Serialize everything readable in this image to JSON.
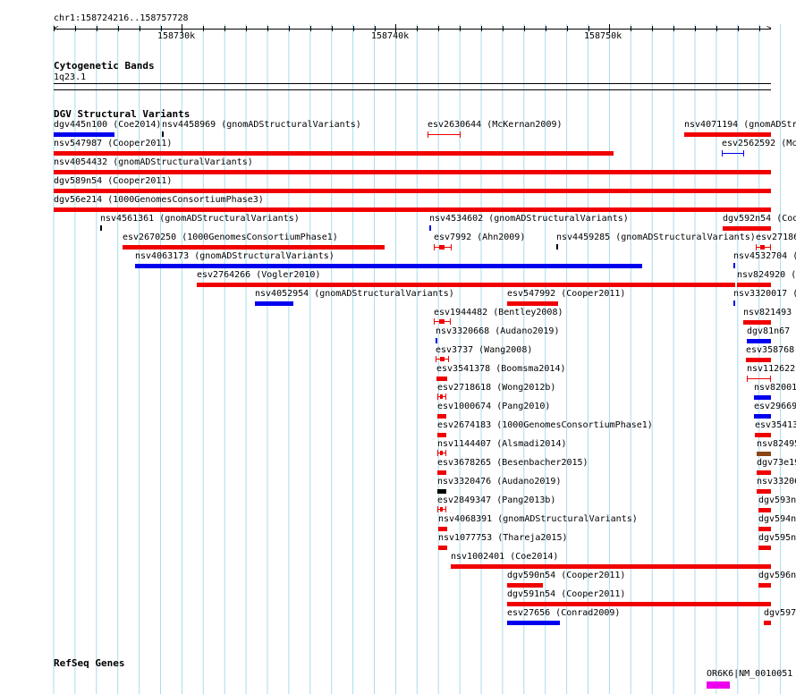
{
  "locus": "chr1:158724216..158757728",
  "ruler": {
    "ticks": [
      "158730k",
      "158740k",
      "158750k"
    ]
  },
  "tracks": {
    "cyto_title": "Cytogenetic Bands",
    "cyto_band": "1q23.1",
    "dgv_title": "DGV Structural Variants",
    "refseq_title": "RefSeq Genes"
  },
  "colors": {
    "red": "#f00000",
    "blue": "#0000ee",
    "brown": "#8b4513",
    "black": "#000000",
    "magenta": "#ee00ee",
    "grid": "#a8dcec"
  },
  "features": [
    {
      "label": "dgv445n100 (Coe2014)",
      "color": "blue",
      "style": "bar"
    },
    {
      "label": "nsv4458969 (gnomADStructuralVariants)",
      "color": "black",
      "style": "tick"
    },
    {
      "label": "esv2630644 (McKernan2009)",
      "color": "red",
      "style": "line"
    },
    {
      "label": "nsv4071194 (gnomADStr",
      "color": "red",
      "style": "bar"
    },
    {
      "label": "nsv547987 (Cooper2011)",
      "color": "red",
      "style": "bar"
    },
    {
      "label": "esv2562592 (Mc",
      "color": "blue",
      "style": "line"
    },
    {
      "label": "nsv4054432 (gnomADStructuralVariants)",
      "color": "red",
      "style": "bar"
    },
    {
      "label": "dgv589n54 (Cooper2011)",
      "color": "red",
      "style": "bar"
    },
    {
      "label": "dgv56e214 (1000GenomesConsortiumPhase3)",
      "color": "red",
      "style": "bar"
    },
    {
      "label": "nsv4561361 (gnomADStructuralVariants)",
      "color": "black",
      "style": "tick"
    },
    {
      "label": "nsv4534602 (gnomADStructuralVariants)",
      "color": "blue",
      "style": "tick"
    },
    {
      "label": "dgv592n54 (Coo",
      "color": "red",
      "style": "bar"
    },
    {
      "label": "esv2670250 (1000GenomesConsortiumPhase1)",
      "color": "red",
      "style": "bar"
    },
    {
      "label": "esv7992 (Ahn2009)",
      "color": "red",
      "style": "line"
    },
    {
      "label": "nsv4459285 (gnomADStructuralVariants)",
      "color": "black",
      "style": "tick"
    },
    {
      "label": "esv27186",
      "color": "red",
      "style": "line"
    },
    {
      "label": "nsv4063173 (gnomADStructuralVariants)",
      "color": "blue",
      "style": "bar"
    },
    {
      "label": "nsv4532704 (",
      "color": "blue",
      "style": "tick"
    },
    {
      "label": "esv2764266 (Vogler2010)",
      "color": "red",
      "style": "bar"
    },
    {
      "label": "nsv824920 (",
      "color": "red",
      "style": "bar"
    },
    {
      "label": "nsv4052954 (gnomADStructuralVariants)",
      "color": "blue",
      "style": "bar"
    },
    {
      "label": "esv547992 (Cooper2011)",
      "color": "red",
      "style": "bar"
    },
    {
      "label": "nsv3320017 (",
      "color": "blue",
      "style": "tick"
    },
    {
      "label": "esv1944482 (Bentley2008)",
      "color": "red",
      "style": "line"
    },
    {
      "label": "nsv821493",
      "color": "red",
      "style": "bar"
    },
    {
      "label": "nsv3320668 (Audano2019)",
      "color": "blue",
      "style": "tick"
    },
    {
      "label": "dgv81n67",
      "color": "blue",
      "style": "bar"
    },
    {
      "label": "esv3737 (Wang2008)",
      "color": "red",
      "style": "line"
    },
    {
      "label": "esv358768",
      "color": "red",
      "style": "bar"
    },
    {
      "label": "esv3541378 (Boomsma2014)",
      "color": "red",
      "style": "bar"
    },
    {
      "label": "nsv112622",
      "color": "red",
      "style": "line"
    },
    {
      "label": "esv2718618 (Wong2012b)",
      "color": "red",
      "style": "line"
    },
    {
      "label": "nsv82001",
      "color": "blue",
      "style": "bar"
    },
    {
      "label": "esv1000674 (Pang2010)",
      "color": "red",
      "style": "bar"
    },
    {
      "label": "esv29669",
      "color": "blue",
      "style": "bar"
    },
    {
      "label": "esv2674183 (1000GenomesConsortiumPhase1)",
      "color": "red",
      "style": "bar"
    },
    {
      "label": "esv35413",
      "color": "red",
      "style": "bar"
    },
    {
      "label": "nsv1144407 (Alsmadi2014)",
      "color": "red",
      "style": "line"
    },
    {
      "label": "nsv82495",
      "color": "brown",
      "style": "bar"
    },
    {
      "label": "esv3678265 (Besenbacher2015)",
      "color": "red",
      "style": "bar"
    },
    {
      "label": "dgv73e19",
      "color": "red",
      "style": "bar"
    },
    {
      "label": "nsv3320476 (Audano2019)",
      "color": "black",
      "style": "bar"
    },
    {
      "label": "nsv33206",
      "color": "red",
      "style": "bar"
    },
    {
      "label": "esv2849347 (Pang2013b)",
      "color": "red",
      "style": "line"
    },
    {
      "label": "dgv593n",
      "color": "red",
      "style": "bar"
    },
    {
      "label": "nsv4068391 (gnomADStructuralVariants)",
      "color": "red",
      "style": "bar"
    },
    {
      "label": "dgv594n",
      "color": "red",
      "style": "bar"
    },
    {
      "label": "nsv1077753 (Thareja2015)",
      "color": "red",
      "style": "bar"
    },
    {
      "label": "dgv595n",
      "color": "red",
      "style": "bar"
    },
    {
      "label": "nsv1002401 (Coe2014)",
      "color": "red",
      "style": "bar"
    },
    {
      "label": "dgv590n54 (Cooper2011)",
      "color": "red",
      "style": "bar"
    },
    {
      "label": "dgv596n",
      "color": "red",
      "style": "bar"
    },
    {
      "label": "dgv591n54 (Cooper2011)",
      "color": "red",
      "style": "bar"
    },
    {
      "label": "esv27656 (Conrad2009)",
      "color": "blue",
      "style": "bar"
    },
    {
      "label": "dgv597",
      "color": "red",
      "style": "bar"
    }
  ],
  "genes": [
    {
      "label": "OR6K6|NM_0010051",
      "color": "magenta",
      "style": "bar"
    }
  ]
}
